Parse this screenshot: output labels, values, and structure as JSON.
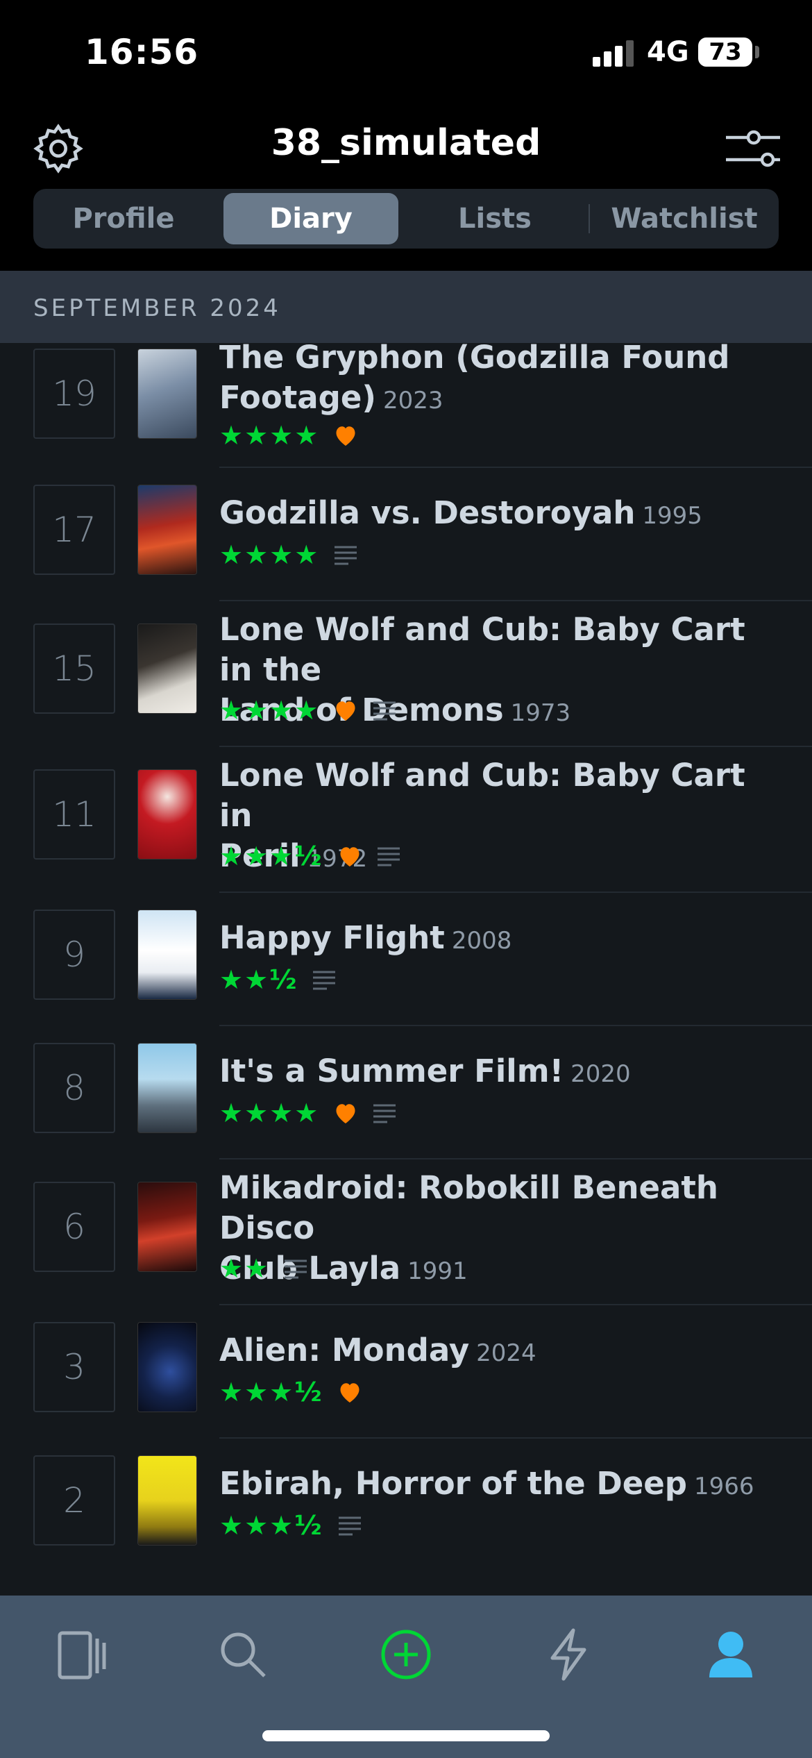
{
  "status_bar": {
    "time": "16:56",
    "network": "4G",
    "battery": "73"
  },
  "header": {
    "title": "38_simulated",
    "settings_icon": "gear-icon",
    "filter_icon": "sliders-icon"
  },
  "tabs": [
    {
      "label": "Profile",
      "active": false
    },
    {
      "label": "Diary",
      "active": true
    },
    {
      "label": "Lists",
      "active": false
    },
    {
      "label": "Watchlist",
      "active": false
    }
  ],
  "section": {
    "label": "SEPTEMBER 2024"
  },
  "entries": [
    {
      "day": "19",
      "title_line1": "The Gryphon (Godzilla Found",
      "title_line2": "Footage)",
      "year": "2023",
      "stars": "★★★★",
      "liked": true,
      "review": false
    },
    {
      "day": "17",
      "title_line1": "Godzilla vs. Destoroyah",
      "title_line2": "",
      "year": "1995",
      "stars": "★★★★",
      "liked": false,
      "review": true
    },
    {
      "day": "15",
      "title_line1": "Lone Wolf and Cub: Baby Cart in the",
      "title_line2": "Land of Demons",
      "year": "1973",
      "stars": "★★★★",
      "liked": true,
      "review": true
    },
    {
      "day": "11",
      "title_line1": "Lone Wolf and Cub: Baby Cart in",
      "title_line2": "Peril",
      "year": "1972",
      "stars": "★★★½",
      "liked": true,
      "review": true
    },
    {
      "day": "9",
      "title_line1": "Happy Flight",
      "title_line2": "",
      "year": "2008",
      "stars": "★★½",
      "liked": false,
      "review": true
    },
    {
      "day": "8",
      "title_line1": "It's a Summer Film!",
      "title_line2": "",
      "year": "2020",
      "stars": "★★★★",
      "liked": true,
      "review": true
    },
    {
      "day": "6",
      "title_line1": "Mikadroid: Robokill Beneath Disco",
      "title_line2": "Club Layla",
      "year": "1991",
      "stars": "★★",
      "liked": false,
      "review": true
    },
    {
      "day": "3",
      "title_line1": "Alien: Monday",
      "title_line2": "",
      "year": "2024",
      "stars": "★★★½",
      "liked": true,
      "review": false
    },
    {
      "day": "2",
      "title_line1": "Ebirah, Horror of the Deep",
      "title_line2": "",
      "year": "1966",
      "stars": "★★★½",
      "liked": false,
      "review": true
    }
  ],
  "colors": {
    "star": "#00d735",
    "heart": "#ff8000",
    "accent_active_tab": "#6a7a8b",
    "profile_icon": "#40bcf4",
    "add_icon": "#00d735"
  },
  "tabbar": [
    {
      "icon": "films-icon"
    },
    {
      "icon": "search-icon"
    },
    {
      "icon": "add-log-icon"
    },
    {
      "icon": "activity-icon"
    },
    {
      "icon": "profile-icon"
    }
  ]
}
